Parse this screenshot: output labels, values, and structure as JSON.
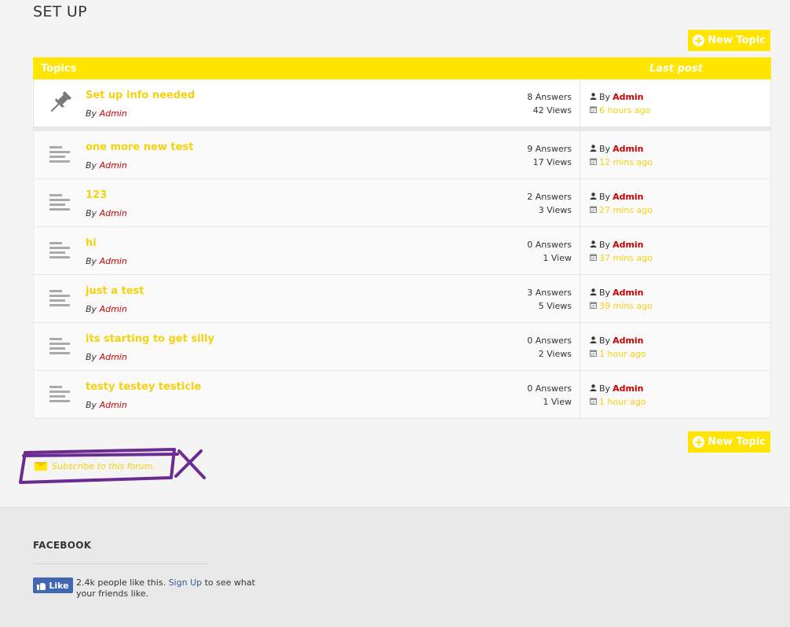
{
  "page": {
    "title": "SET UP"
  },
  "buttons": {
    "new_topic": "New Topic"
  },
  "table": {
    "header_topics": "Topics",
    "header_last_post": "Last post",
    "rows": [
      {
        "title": "Set up info needed",
        "by_prefix": "By",
        "author": "Admin",
        "answers": "8 Answers",
        "views": "42 Views",
        "last_by_prefix": "By",
        "last_by": "Admin",
        "last_ago": "6 hours ago",
        "sticky": true
      },
      {
        "title": "one more new test",
        "by_prefix": "By",
        "author": "Admin",
        "answers": "9 Answers",
        "views": "17 Views",
        "last_by_prefix": "By",
        "last_by": "Admin",
        "last_ago": "12 mins ago"
      },
      {
        "title": "123",
        "by_prefix": "By",
        "author": "Admin",
        "answers": "2 Answers",
        "views": "3 Views",
        "last_by_prefix": "By",
        "last_by": "Admin",
        "last_ago": "27 mins ago"
      },
      {
        "title": "hi",
        "by_prefix": "By",
        "author": "Admin",
        "answers": "0 Answers",
        "views": "1 View",
        "last_by_prefix": "By",
        "last_by": "Admin",
        "last_ago": "37 mins ago"
      },
      {
        "title": "just a test",
        "by_prefix": "By",
        "author": "Admin",
        "answers": "3 Answers",
        "views": "5 Views",
        "last_by_prefix": "By",
        "last_by": "Admin",
        "last_ago": "39 mins ago"
      },
      {
        "title": "its starting to get silly",
        "by_prefix": "By",
        "author": "Admin",
        "answers": "0 Answers",
        "views": "2 Views",
        "last_by_prefix": "By",
        "last_by": "Admin",
        "last_ago": "1 hour ago"
      },
      {
        "title": "testy testey testicle",
        "by_prefix": "By",
        "author": "Admin",
        "answers": "0 Answers",
        "views": "1 View",
        "last_by_prefix": "By",
        "last_by": "Admin",
        "last_ago": "1 hour ago"
      }
    ]
  },
  "subscribe": {
    "label": "Subscribe to this forum."
  },
  "footer": {
    "facebook_title": "FACEBOOK",
    "like_label": "Like",
    "like_text": "2.4k people like this.",
    "signup_link": "Sign Up",
    "like_text_tail": "to see what your friends like."
  },
  "colors": {
    "accent": "#ffe500",
    "link_title": "#f5d20b",
    "author": "#cc0000",
    "facebook": "#4267b2",
    "annotation": "#6a2c91"
  },
  "icons": {
    "row_sticky": "pin-icon",
    "row_normal": "topic-lines-icon",
    "user": "user-icon",
    "date": "calendar-icon",
    "subscribe": "mail-icon",
    "new_topic": "plus-circle-icon",
    "like": "thumbs-up-icon"
  }
}
